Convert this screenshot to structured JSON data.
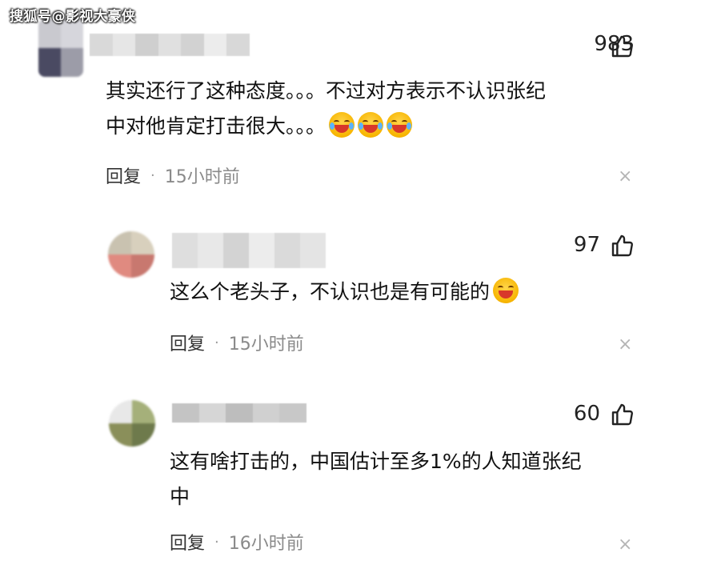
{
  "watermark": "搜狐号@影视大豪侠",
  "comments": [
    {
      "likes": "983",
      "line1": "其实还行了这种态度。。。不过对方表示不认识张纪",
      "line2": "中对他肯定打击很大。。。",
      "emoji": "laughing-tears-emoji",
      "reply_label": "回复",
      "dot": "·",
      "time": "15小时前",
      "close": "×"
    },
    {
      "likes": "97",
      "line1": "这么个老头子，不认识也是有可能的",
      "emoji": "grinning-emoji",
      "reply_label": "回复",
      "dot": "·",
      "time": "15小时前",
      "close": "×"
    },
    {
      "likes": "60",
      "line1": "这有啥打击的，中国估计至多1%的人知道张纪",
      "line2": "中",
      "reply_label": "回复",
      "dot": "·",
      "time": "16小时前",
      "close": "×"
    }
  ]
}
